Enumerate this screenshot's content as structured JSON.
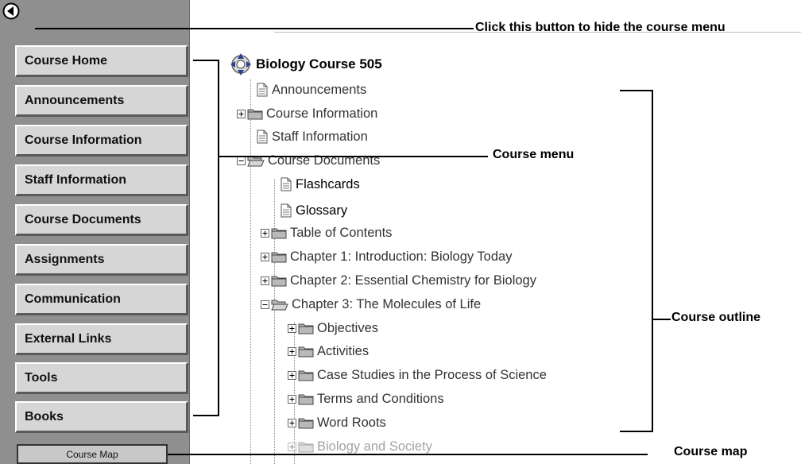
{
  "sidebar": {
    "hide_button_icon": "left-arrow-circle-icon",
    "menu_items": [
      {
        "label": "Course Home"
      },
      {
        "label": "Announcements"
      },
      {
        "label": "Course Information"
      },
      {
        "label": "Staff Information"
      },
      {
        "label": "Course Documents"
      },
      {
        "label": "Assignments"
      },
      {
        "label": "Communication"
      },
      {
        "label": "External Links"
      },
      {
        "label": "Tools"
      },
      {
        "label": "Books"
      }
    ],
    "course_map_label": "Course Map"
  },
  "outline": {
    "title": "Biology Course 505",
    "rows": [
      {
        "label": "Announcements",
        "icon": "document-icon"
      },
      {
        "label": "Course Information",
        "icon": "folder-icon"
      },
      {
        "label": "Staff Information",
        "icon": "document-icon"
      },
      {
        "label": "Course Documents",
        "icon": "open-folder-icon"
      },
      {
        "label": "Flashcards",
        "icon": "document-icon"
      },
      {
        "label": "Glossary",
        "icon": "document-icon"
      },
      {
        "label": "Table of Contents",
        "icon": "folder-icon"
      },
      {
        "label": "Chapter 1: Introduction: Biology Today",
        "icon": "folder-icon"
      },
      {
        "label": "Chapter 2: Essential Chemistry for Biology",
        "icon": "folder-icon"
      },
      {
        "label": "Chapter 3: The Molecules of Life",
        "icon": "open-folder-icon"
      },
      {
        "label": "Objectives",
        "icon": "folder-icon"
      },
      {
        "label": "Activities",
        "icon": "folder-icon"
      },
      {
        "label": "Case Studies in the Process of Science",
        "icon": "folder-icon"
      },
      {
        "label": "Terms and Conditions",
        "icon": "folder-icon"
      },
      {
        "label": "Word Roots",
        "icon": "folder-icon"
      },
      {
        "label": "Biology and Society",
        "icon": "folder-icon"
      }
    ]
  },
  "callouts": {
    "hide_menu": "Click this button to hide the course menu",
    "course_menu": "Course menu",
    "course_outline": "Course outline",
    "course_map": "Course map"
  }
}
